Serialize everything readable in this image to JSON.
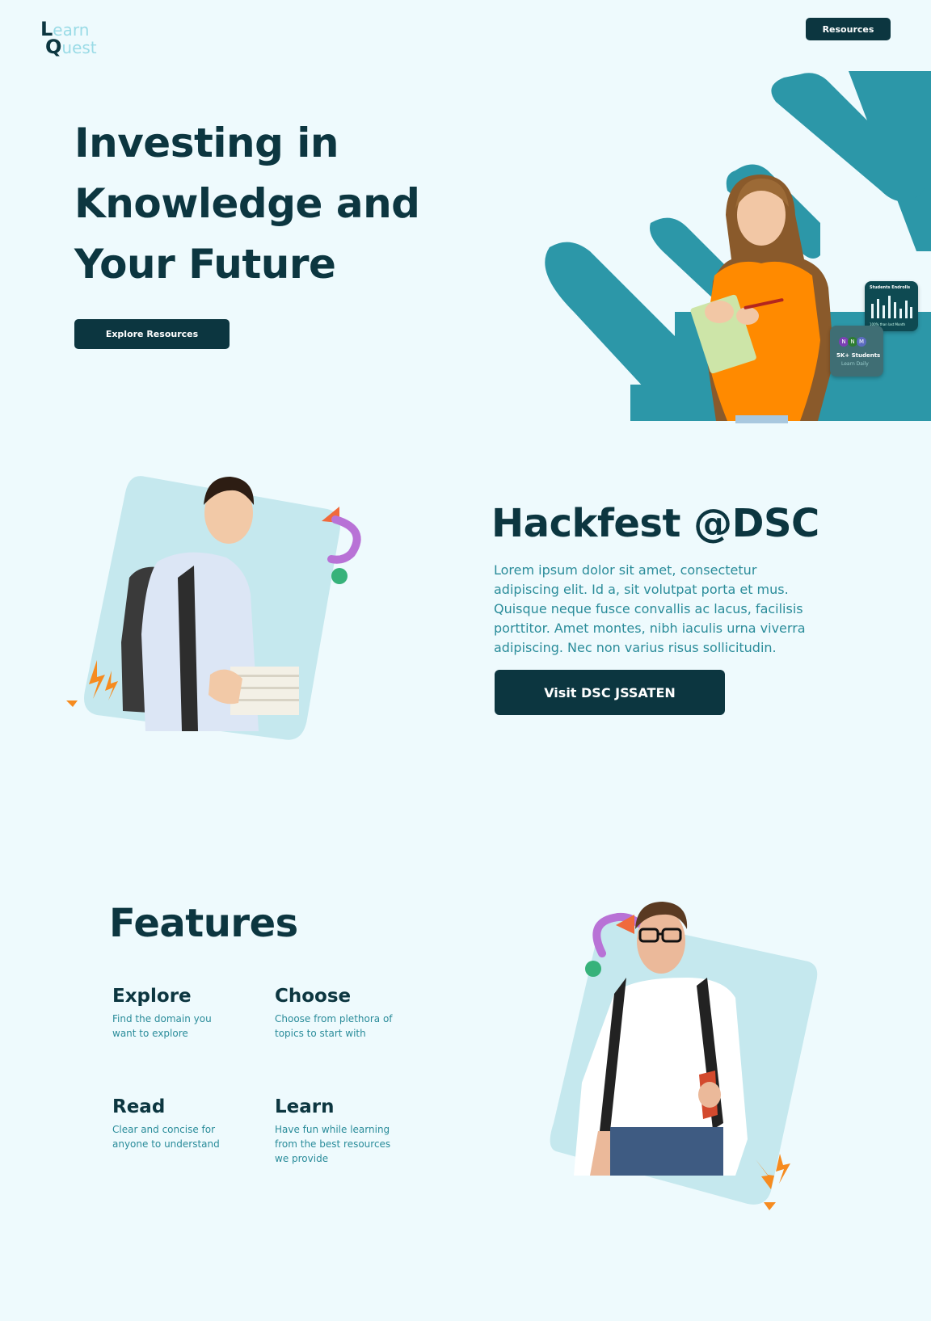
{
  "header": {
    "logo_first_initial": "L",
    "logo_first_rest": "earn",
    "logo_second_initial": "Q",
    "logo_second_rest": "uest",
    "resources_label": "Resources"
  },
  "hero": {
    "title_line1": "Investing in",
    "title_line2": "Knowledge and",
    "title_line3": "Your Future",
    "cta_label": "Explore Resources",
    "students_card": {
      "title": "Students Endrolls",
      "caption": "100% than last Month"
    },
    "enroll_card": {
      "avatars": [
        "N",
        "N",
        "M"
      ],
      "count_label": "5K+ Students",
      "sub_label": "Learn Daily"
    }
  },
  "hackfest": {
    "title": "Hackfest @DSC",
    "body": "Lorem ipsum dolor sit amet, consectetur adipiscing elit. Id a, sit volutpat porta et mus. Quisque neque fusce convallis ac lacus, facilisis porttitor. Amet montes, nibh iaculis urna viverra adipiscing. Nec non varius risus sollicitudin.",
    "cta_label": "Visit DSC JSSATEN"
  },
  "features": {
    "title": "Features",
    "items": [
      {
        "title": "Explore",
        "text": "Find the domain you want to explore"
      },
      {
        "title": "Choose",
        "text": "Choose from plethora of topics to start with"
      },
      {
        "title": "Read",
        "text": "Clear and concise for anyone to understand"
      },
      {
        "title": "Learn",
        "text": "Have fun while learning from the best resources we provide"
      }
    ]
  },
  "colors": {
    "background": "#EEFAFD",
    "dark": "#0C3640",
    "teal": "#2C97A8",
    "text_teal": "#2A8C9A",
    "light_teal_panel": "#C5E8EE",
    "orange": "#F68B1F",
    "purple": "#B872D6",
    "green": "#37B27A",
    "coral": "#F06A3C"
  }
}
